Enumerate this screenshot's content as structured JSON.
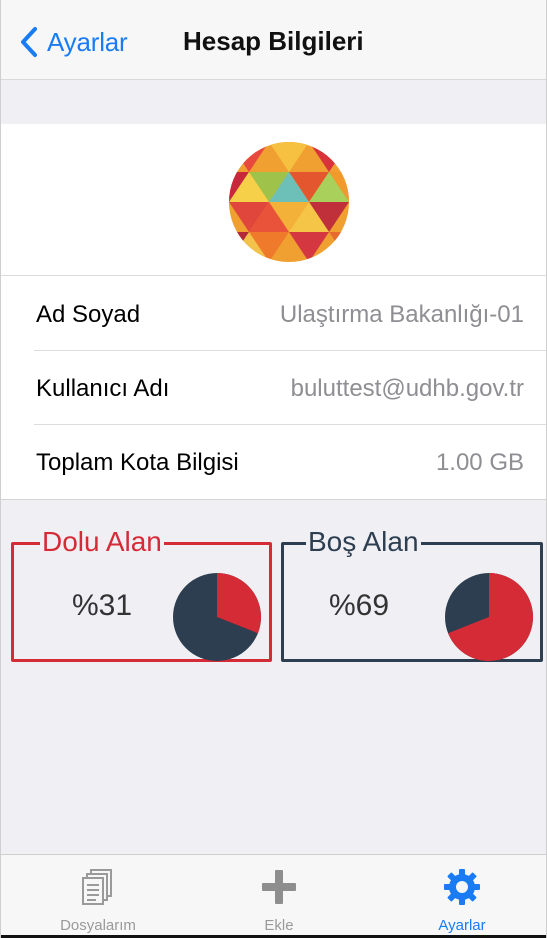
{
  "navbar": {
    "back_label": "Ayarlar",
    "title": "Hesap Bilgileri"
  },
  "profile": {
    "rows": [
      {
        "label": "Ad Soyad",
        "value": "Ulaştırma Bakanlığı-01"
      },
      {
        "label": "Kullanıcı Adı",
        "value": "buluttest@udhb.gov.tr"
      },
      {
        "label": "Toplam Kota Bilgisi",
        "value": "1.00 GB"
      }
    ]
  },
  "storage": {
    "used": {
      "title": "Dolu Alan",
      "percent_text": "%31",
      "fraction": 0.31,
      "color": "#d42b36"
    },
    "free": {
      "title": "Boş Alan",
      "percent_text": "%69",
      "fraction": 0.69,
      "color": "#2c3e50"
    }
  },
  "tabbar": {
    "items": [
      {
        "label": "Dosyalarım",
        "icon": "documents-icon",
        "active": false
      },
      {
        "label": "Ekle",
        "icon": "plus-icon",
        "active": false
      },
      {
        "label": "Ayarlar",
        "icon": "gear-icon",
        "active": true
      }
    ]
  },
  "colors": {
    "accent": "#1a7cf5",
    "used_red": "#d42b36",
    "free_navy": "#2c3e50"
  }
}
